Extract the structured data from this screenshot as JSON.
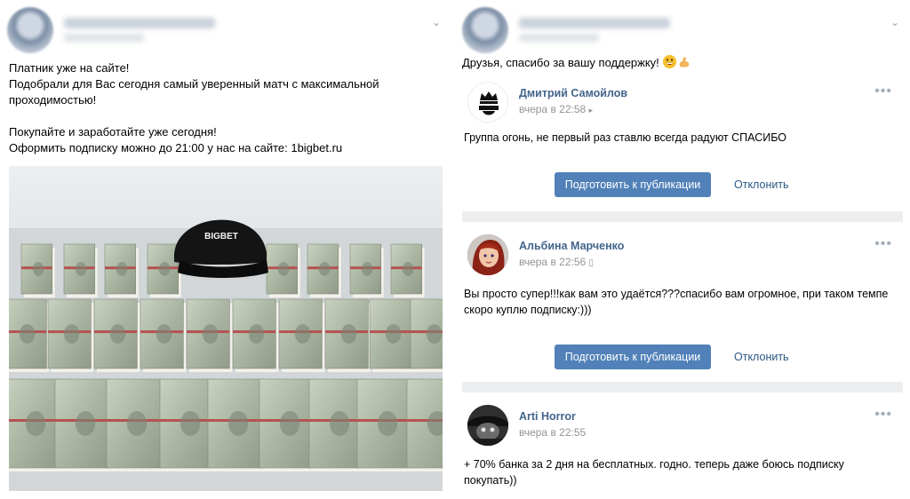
{
  "left_post": {
    "lines": [
      "Платник уже на сайте!",
      "Подобрали для Вас сегодня самый уверенный матч с максимальной",
      "проходимостью!",
      "Покупайте и заработайте уже сегодня!",
      "Оформить подписку можно до 21:00 у нас на сайте: 1bigbet.ru"
    ],
    "cap_text": "BIGBET"
  },
  "right_post": {
    "thanks_text": "Друзья, спасибо за вашу поддержку!"
  },
  "comments": [
    {
      "author": "Дмитрий Самойлов",
      "time": "вчера в 22:58",
      "text_lines": [
        "Группа огонь, не первый раз ставлю всегда радуют СПАСИБО"
      ],
      "avatar_icon": "barbershop-crown-logo"
    },
    {
      "author": "Альбина Марченко",
      "time": "вчера в 22:56",
      "text_lines": [
        "Вы просто супер!!!как вам это удаётся???спасибо вам огромное, при таком темпе",
        "скоро куплю подписку:)))"
      ],
      "avatar_icon": "cartoon-girl-avatar"
    },
    {
      "author": "Arti Horror",
      "time": "вчера в 22:55",
      "text_lines": [
        "+ 70% банка за 2 дня на бесплатных. годно. теперь даже боюсь подписку",
        "покупать))"
      ],
      "avatar_icon": "dark-photo-avatar"
    }
  ],
  "actions": {
    "publish_label": "Подготовить к публикации",
    "reject_label": "Отклонить"
  },
  "colors": {
    "link": "#42648b",
    "button": "#5181b8",
    "muted": "#939393",
    "separator": "#edeef0"
  }
}
